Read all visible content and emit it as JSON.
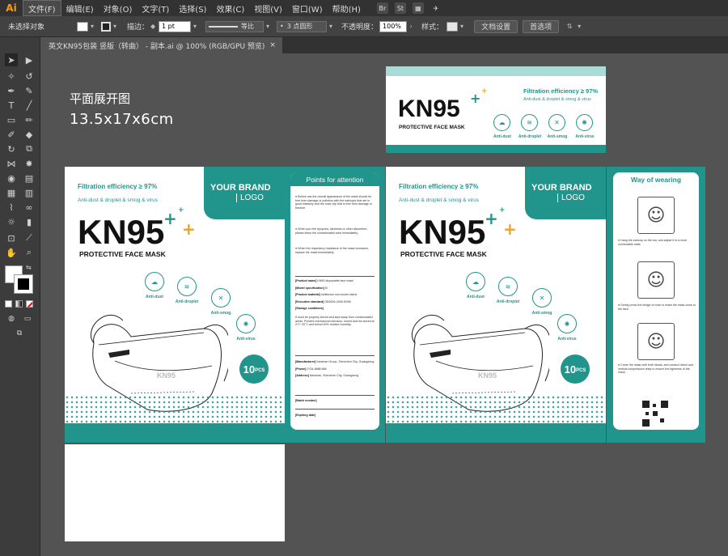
{
  "app": {
    "logo": "Ai"
  },
  "menu": [
    {
      "label": "文件(F)",
      "active": true
    },
    {
      "label": "编辑(E)"
    },
    {
      "label": "对象(O)"
    },
    {
      "label": "文字(T)"
    },
    {
      "label": "选择(S)"
    },
    {
      "label": "效果(C)"
    },
    {
      "label": "视图(V)"
    },
    {
      "label": "窗口(W)"
    },
    {
      "label": "帮助(H)"
    }
  ],
  "menu_icons": [
    "br-icon",
    "st-icon",
    "layout-icon",
    "rocket-icon"
  ],
  "menu_icon_text": {
    "br": "Br",
    "st": "St"
  },
  "control": {
    "selection": "未选择对象",
    "stroke_label": "描边：",
    "stroke_value": "1 pt",
    "uniform": "等比",
    "brush": "3 点圆形",
    "opacity_label": "不透明度：",
    "opacity_value": "100%",
    "style_label": "样式：",
    "doc_setup": "文档设置",
    "preferences": "首选项"
  },
  "tab": {
    "title": "英文KN95包装 竖版（转曲） - 副本.ai @ 100% (RGB/GPU 预览)",
    "close": "×"
  },
  "canvas": {
    "heading": "平面展开图",
    "dimensions": "13.5x17x6cm"
  },
  "design": {
    "kn95": "KN95",
    "protective": "PROTECTIVE FACE MASK",
    "filtration": "Filtration efficiency ≥ 97%",
    "filtration_sub": "Anti-dust & droplet & smog & virus",
    "brand": "YOUR BRAND",
    "logo": "LOGO",
    "pcs_number": "10",
    "pcs_unit": "PCS",
    "icons": [
      "Anti-dust",
      "Anti-droplet",
      "Anti-smog",
      "Anti-virus"
    ],
    "mask_emboss": "KN95",
    "points_title": "Points for attention",
    "points": [
      "Before use,the overall appearance of the mask should be free from damage or pollution,with the earloops that are in good elasticity and the nose clip that is free from damage or fracture.",
      "When you feel dyspnea, dizziness or other discomfort, please leave the contaminated area immediately.",
      "When the respiratory resistance of the mask increases, replace the mask immediately."
    ],
    "specs": [
      {
        "k": "[Product name]",
        "v": "KN95 disposable face mask"
      },
      {
        "k": "[Model specification]",
        "v": "M"
      },
      {
        "k": "[Product material]",
        "v": "meltblown non-woven fabric"
      },
      {
        "k": "[Executive standard]",
        "v": "GB2626-2006 KN95"
      },
      {
        "k": "[Storage conditions]",
        "v": ""
      }
    ],
    "storage_text": "It must be properly stored and kept away from contaminated areas. Prevent mechanical extrusion, humid dust be stored at 0°C~20°C and below 50% relative humidity.",
    "manufacturer": [
      {
        "k": "[Manufacturer]",
        "v": "Nanshan Group, Shenzhen City, Guangdong"
      },
      {
        "k": "[Phone]",
        "v": "0734-8888 888"
      },
      {
        "k": "[Address]",
        "v": "Nanshan, Shenzhen City, Guangdong"
      }
    ],
    "batch": "[Batch number]",
    "expiry": "[Expiring date]",
    "wearing_title": "Way of wearing",
    "steps": [
      "Hang the earloop on the ear, and adjust it to a more comfortable state.",
      "Gently press the bridge of nose to make the mask close to the face.",
      "Cover the mask with both hands, and conduct direct and vertical compression tests to ensure the tightness of the mask."
    ]
  },
  "colors": {
    "teal": "#21948b",
    "canvas": "#535353",
    "ui_dark": "#323232"
  }
}
